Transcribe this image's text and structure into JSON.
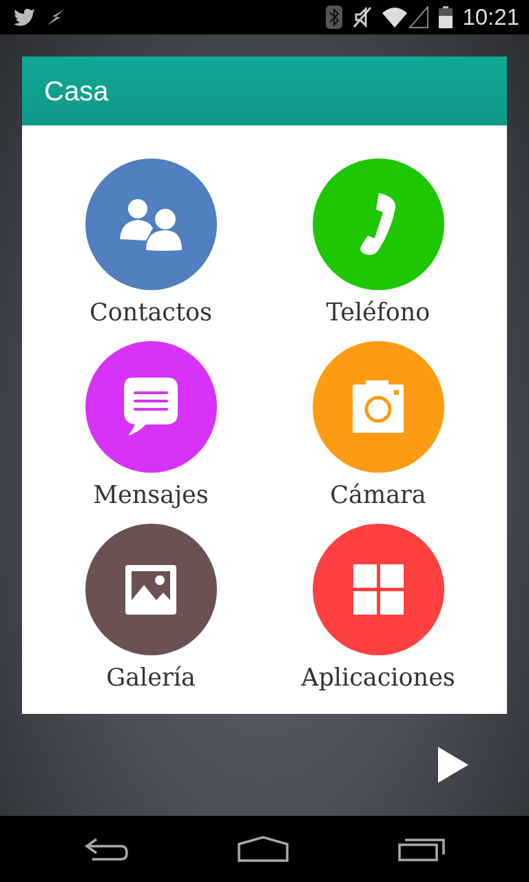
{
  "status_bar": {
    "time": "10:21"
  },
  "header": {
    "title": "Casa"
  },
  "apps": [
    {
      "label": "Contactos",
      "kind": "contacts",
      "color": "#5080c0"
    },
    {
      "label": "Teléfono",
      "kind": "phone",
      "color": "#1ec800"
    },
    {
      "label": "Mensajes",
      "kind": "messages",
      "color": "#d733f8"
    },
    {
      "label": "Cámara",
      "kind": "camera",
      "color": "#fd9c12"
    },
    {
      "label": "Galería",
      "kind": "gallery",
      "color": "#6b514f"
    },
    {
      "label": "Aplicaciones",
      "kind": "apps",
      "color": "#fe4040"
    }
  ]
}
